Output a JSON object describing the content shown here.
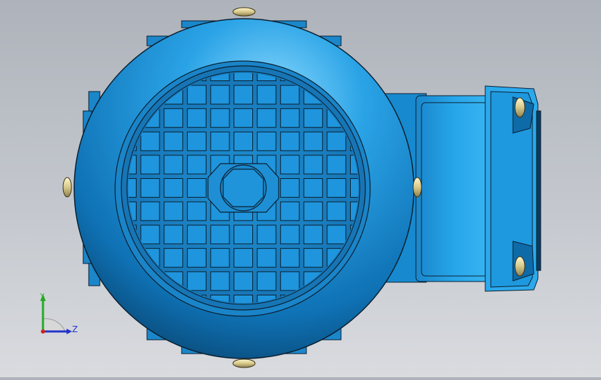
{
  "viewport": {
    "background_top": "#aeb3bb",
    "background_bottom": "#d9dbdf",
    "view": "motor-end-view"
  },
  "model": {
    "body_color": "#1e96dc",
    "body_dark": "#0b5d96",
    "body_light": "#66c8f5",
    "bolt_color": "#d9cc8a",
    "edge_color": "#0a1e2e",
    "grille_rows": 9,
    "grille_cols": 9
  },
  "triad": {
    "y_label": "Y",
    "z_label": "Z",
    "y_color": "#22aa22",
    "z_color": "#2233cc",
    "x_color": "#cc2222"
  }
}
